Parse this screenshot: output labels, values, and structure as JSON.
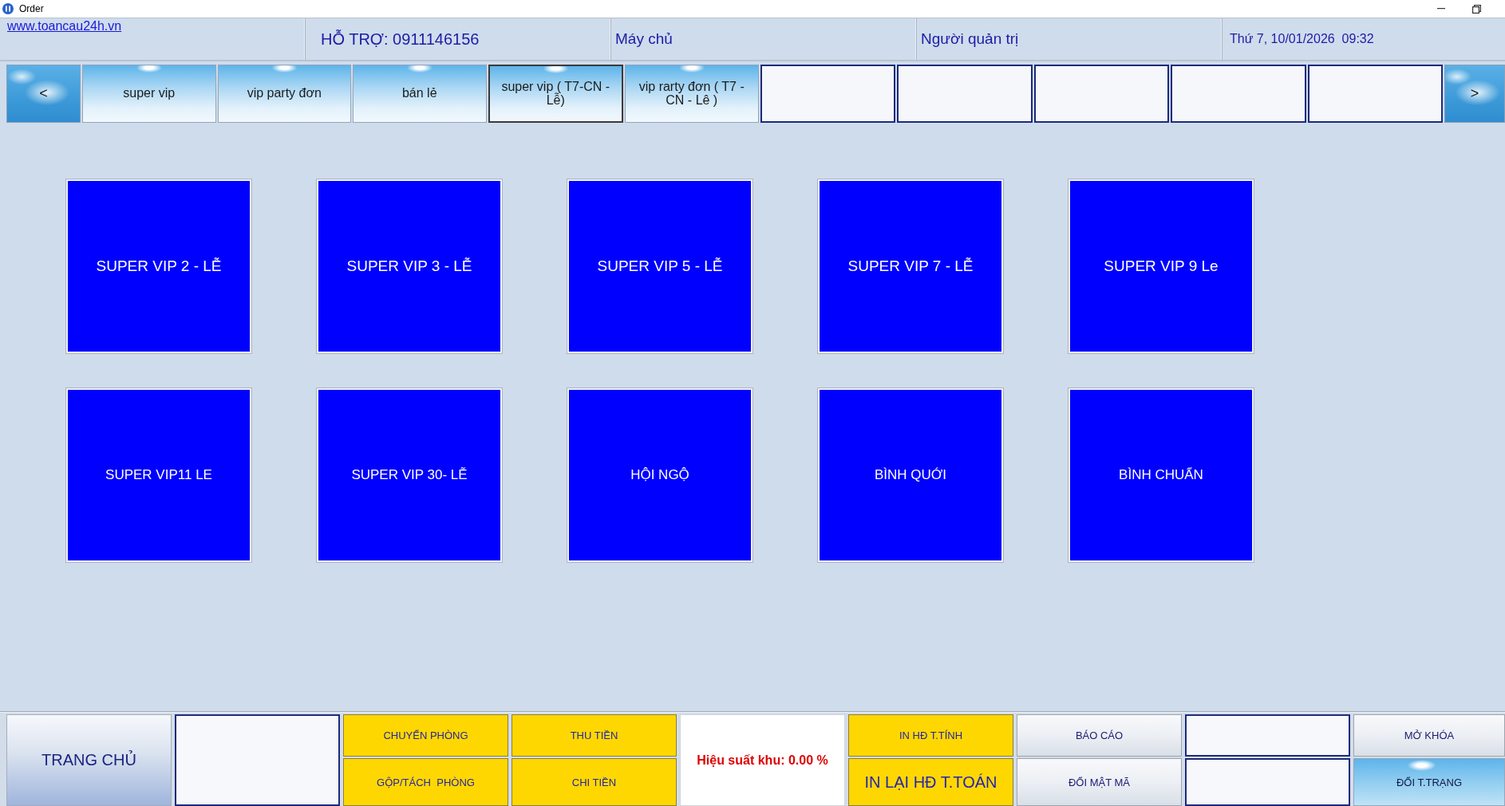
{
  "window": {
    "title": "Order"
  },
  "info_bar": {
    "website_link": "www.toancau24h.vn",
    "support": "HỖ TRỢ: 0911146156",
    "server": "Máy chủ",
    "user": "Người quản trị",
    "datetime": "Thứ 7, 10/01/2026  09:32"
  },
  "area_tabs": {
    "prev_button": "<",
    "tabs": [
      {
        "kind": "labeled",
        "label": "super vip",
        "selected": false
      },
      {
        "kind": "labeled",
        "label": "vip party đơn",
        "selected": false
      },
      {
        "kind": "labeled",
        "label": "bán lẻ",
        "selected": false
      },
      {
        "kind": "labeled",
        "label": "super vip ( T7-CN - Lễ)",
        "selected": true
      },
      {
        "kind": "labeled",
        "label": "vip rarty đơn ( T7 - CN - Lê )",
        "selected": false
      },
      {
        "kind": "blank",
        "selected": false
      },
      {
        "kind": "blank",
        "selected": false
      },
      {
        "kind": "blank",
        "selected": false
      },
      {
        "kind": "blank",
        "selected": false
      },
      {
        "kind": "blank",
        "selected": false
      }
    ],
    "next_button": ">"
  },
  "rooms": [
    {
      "name": "SUPER VIP 2 - LỄ"
    },
    {
      "name": "SUPER VIP 3 - LỄ"
    },
    {
      "name": "SUPER VIP 5 - LỄ"
    },
    {
      "name": "SUPER VIP 7 - LỄ"
    },
    {
      "name": "SUPER VIP 9 Le"
    },
    {
      "name": "SUPER VIP11 LE"
    },
    {
      "name": "SUPER VIP 30- LỄ"
    },
    {
      "name": "HỘI NGỘ"
    },
    {
      "name": "BÌNH QUỚI"
    },
    {
      "name": "BÌNH CHUẨN"
    }
  ],
  "bottom_bar": {
    "columns": [
      {
        "cells": [
          {
            "kind": "home",
            "label": "TRANG CHỦ"
          }
        ]
      },
      {
        "cells": [
          {
            "kind": "blank"
          }
        ]
      },
      {
        "cells": [
          {
            "kind": "action",
            "label": "CHUYỂN PHÒNG"
          },
          {
            "kind": "action",
            "label": "GỘP/TÁCH  PHÒNG"
          }
        ]
      },
      {
        "cells": [
          {
            "kind": "action",
            "label": "THU TIỀN"
          },
          {
            "kind": "action",
            "label": "CHI TIỀN"
          }
        ]
      },
      {
        "cells": [
          {
            "kind": "stat",
            "label": "Hiệu suất khu: 0.00 %"
          }
        ]
      },
      {
        "cells": [
          {
            "kind": "action",
            "label": "IN HĐ T.TÍNH"
          },
          {
            "kind": "strong",
            "label": "IN LẠI HĐ T.TOÁN"
          }
        ]
      },
      {
        "cells": [
          {
            "kind": "menu",
            "label": "BÁO CÁO"
          },
          {
            "kind": "menu",
            "label": "ĐỔI MẬT MÃ"
          }
        ]
      },
      {
        "cells": [
          {
            "kind": "blank"
          },
          {
            "kind": "blank"
          }
        ]
      },
      {
        "cells": [
          {
            "kind": "menu",
            "label": "MỞ KHÓA"
          },
          {
            "kind": "picture",
            "label": "ĐỔI T.TRẠNG"
          }
        ]
      }
    ]
  }
}
